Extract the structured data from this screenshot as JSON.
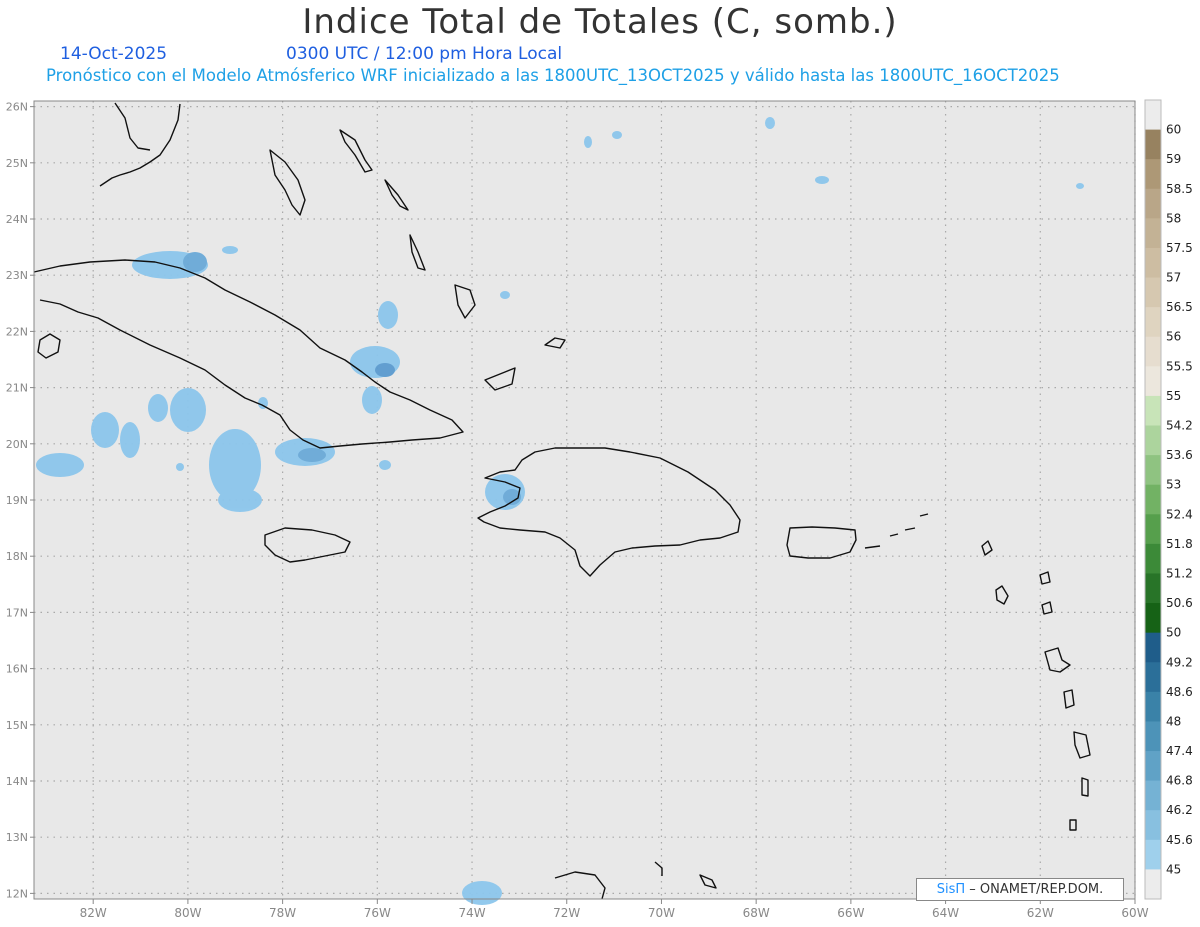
{
  "header": {
    "title": "Indice Total de Totales (C, somb.)",
    "date": "14-Oct-2025",
    "time": "0300 UTC / 12:00 pm Hora Local",
    "description": "Pronóstico con el Modelo Atmósferico WRF inicializado a las 1800UTC_13OCT2025 y válido hasta las  1800UTC_16OCT2025"
  },
  "map": {
    "lon_range": [
      -83.25,
      -60.0
    ],
    "lat_range": [
      11.9,
      26.1
    ],
    "background_color": "#e8e8e8",
    "grid": "dotted",
    "lon_ticks": [
      "82W",
      "80W",
      "78W",
      "76W",
      "74W",
      "72W",
      "70W",
      "68W",
      "66W",
      "64W",
      "62W",
      "60W"
    ],
    "lat_ticks": [
      "26N",
      "25N",
      "24N",
      "23N",
      "22N",
      "21N",
      "20N",
      "19N",
      "18N",
      "17N",
      "16N",
      "15N",
      "14N",
      "13N",
      "12N"
    ]
  },
  "colorbar": {
    "labels": [
      "60",
      "59",
      "58.5",
      "58",
      "57.5",
      "57",
      "56.5",
      "56",
      "55.5",
      "55",
      "54.2",
      "53.6",
      "53",
      "52.4",
      "51.8",
      "51.2",
      "50.6",
      "50",
      "49.2",
      "48.6",
      "48",
      "47.4",
      "46.8",
      "46.2",
      "45.6",
      "45"
    ],
    "colors": [
      "#978260",
      "#ad9876",
      "#b9a688",
      "#c3b295",
      "#cdbda2",
      "#d6c8b0",
      "#dfd4c0",
      "#e6ddcf",
      "#ece7dd",
      "#c8e4b8",
      "#acd49d",
      "#8fc381",
      "#72b264",
      "#569f4c",
      "#3c8a38",
      "#287428",
      "#166216",
      "#1f5d8a",
      "#2b6f99",
      "#3a82a8",
      "#4d93b8",
      "#60a2c6",
      "#75b2d4",
      "#88c0e0",
      "#9fd0ec"
    ]
  },
  "footer": {
    "brand": "SisΠ",
    "org": " – ONAMET/REP.DOM."
  }
}
